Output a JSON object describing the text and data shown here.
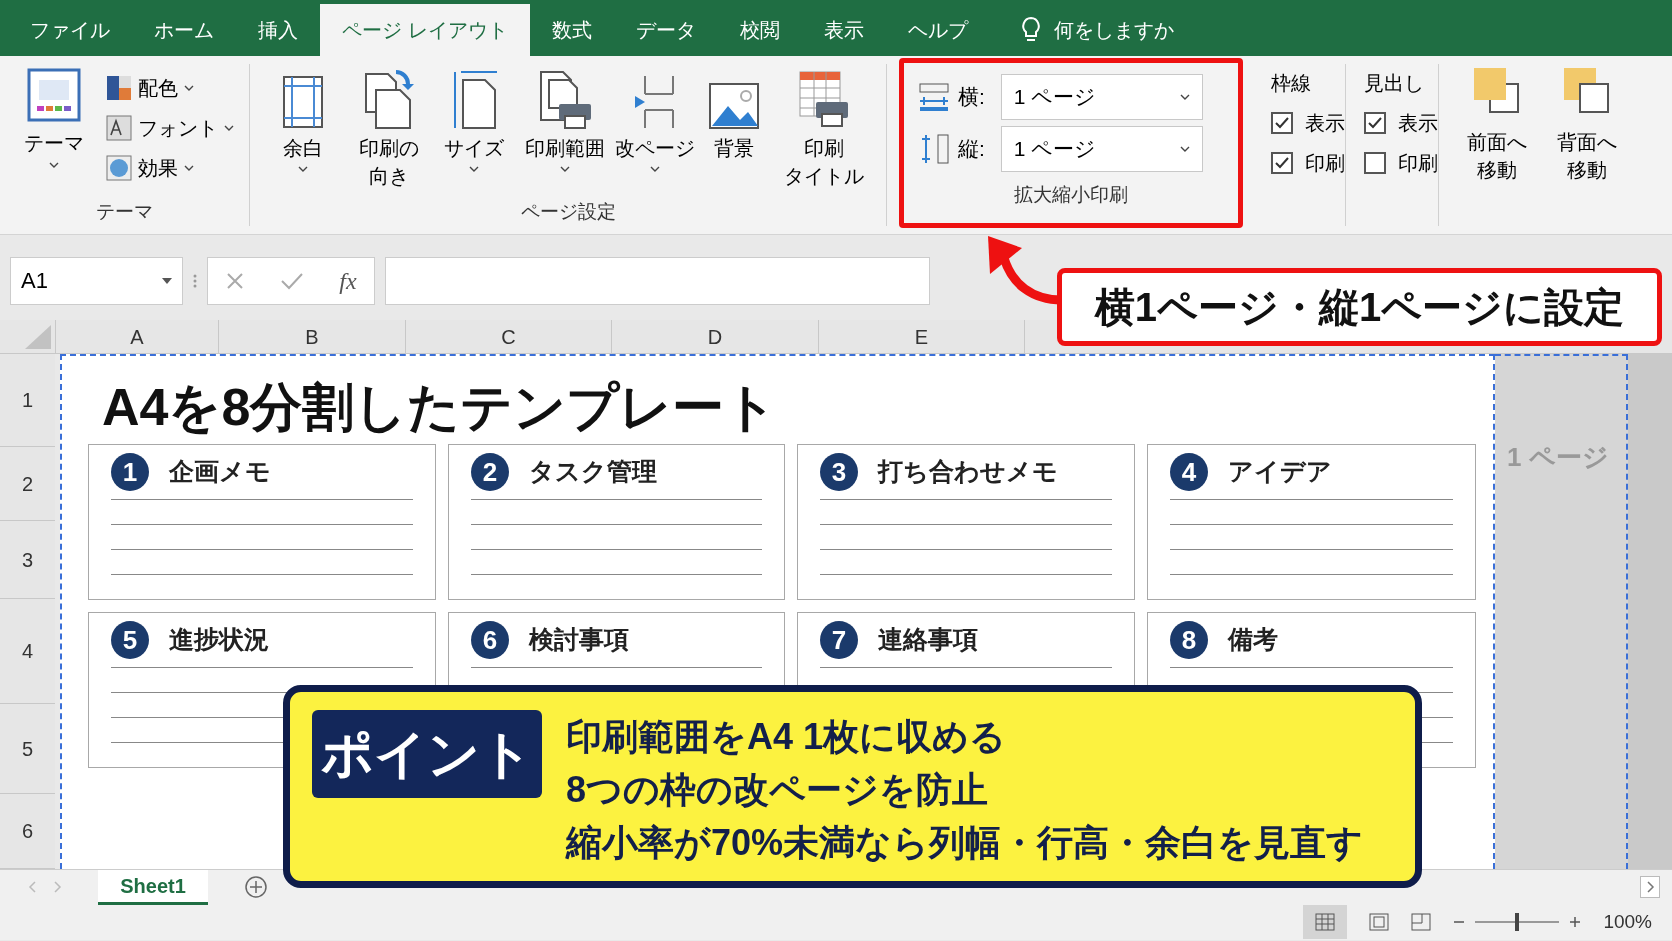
{
  "tabs": [
    {
      "label": "ファイル",
      "selected": false
    },
    {
      "label": "ホーム",
      "selected": false
    },
    {
      "label": "挿入",
      "selected": false
    },
    {
      "label": "ページ レイアウト",
      "selected": true
    },
    {
      "label": "数式",
      "selected": false
    },
    {
      "label": "データ",
      "selected": false
    },
    {
      "label": "校閲",
      "selected": false
    },
    {
      "label": "表示",
      "selected": false
    },
    {
      "label": "ヘルプ",
      "selected": false
    }
  ],
  "tell_me": "何をしますか",
  "ribbon": {
    "theme": {
      "big": "テーマ",
      "items": [
        "配色",
        "フォント",
        "効果"
      ],
      "label": "テーマ"
    },
    "page_setup": {
      "buttons": [
        "余白",
        "印刷の向き",
        "サイズ",
        "印刷範囲",
        "改ページ",
        "背景",
        "印刷タイトル"
      ],
      "label": "ページ設定"
    },
    "scale": {
      "rows": [
        {
          "label": "横:",
          "value": "1 ページ"
        },
        {
          "label": "縦:",
          "value": "1 ページ"
        }
      ],
      "label": "拡大縮小印刷"
    },
    "gridlines": {
      "title": "枠線",
      "options": [
        {
          "label": "表示",
          "checked": true
        },
        {
          "label": "印刷",
          "checked": true
        }
      ]
    },
    "headings": {
      "title": "見出し",
      "options": [
        {
          "label": "表示",
          "checked": true
        },
        {
          "label": "印刷",
          "checked": false
        }
      ]
    },
    "arrange": [
      "前面へ移動",
      "背面へ移動"
    ]
  },
  "formula_bar": {
    "name_box": "A1",
    "fx": "fx"
  },
  "columns": [
    "A",
    "B",
    "C",
    "D",
    "E"
  ],
  "rows": [
    "1",
    "2",
    "3",
    "4",
    "5",
    "6"
  ],
  "sheet": {
    "title": "A4を8分割したテンプレート",
    "page_label": "1 ページ",
    "cards": [
      {
        "number": "1",
        "label": "企画メモ"
      },
      {
        "number": "2",
        "label": "タスク管理"
      },
      {
        "number": "3",
        "label": "打ち合わせメモ"
      },
      {
        "number": "4",
        "label": "アイデア"
      },
      {
        "number": "5",
        "label": "進捗状況"
      },
      {
        "number": "6",
        "label": "検討事項"
      },
      {
        "number": "7",
        "label": "連絡事項"
      },
      {
        "number": "8",
        "label": "備考"
      }
    ]
  },
  "callout": "横1ページ・縦1ページに設定",
  "point": {
    "badge": "ポイント",
    "lines": [
      "印刷範囲をA4 1枚に収める",
      "8つの枠の改ページを防止",
      "縮小率が70%未満なら列幅・行高・余白を見直す"
    ]
  },
  "sheet_tabs": [
    {
      "label": "Sheet1",
      "selected": true
    }
  ],
  "zoom_slider": {
    "level": 0.5
  },
  "zoom": "100%"
}
